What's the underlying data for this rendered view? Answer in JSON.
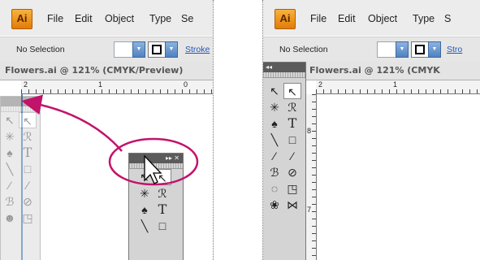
{
  "left_panel": {
    "app_logo": "Ai",
    "menus": [
      "File",
      "Edit",
      "Object",
      "Type",
      "Se"
    ],
    "control_bar": {
      "selection_label": "No Selection",
      "stroke_label": "Stroke"
    },
    "doc_tab": {
      "title": "Flowers.ai @ 121% (CMYK/Preview)"
    },
    "ruler": {
      "nums": [
        "2",
        "1",
        "0"
      ]
    },
    "floating_toolbox": {
      "tools": [
        "↖",
        "↖",
        "✳",
        "ℛ",
        "♠",
        "T",
        "╲",
        "□"
      ],
      "header_icons": "▸▸ ✕"
    },
    "ghost_toolbox": {
      "tools": [
        "↖",
        "↖",
        "✳",
        "ℛ",
        "♠",
        "T",
        "╲",
        "□",
        "⁄",
        "⁄",
        "ℬ",
        "⊘",
        "☻",
        "◳"
      ]
    }
  },
  "right_panel": {
    "app_logo": "Ai",
    "menus": [
      "File",
      "Edit",
      "Object",
      "Type",
      "S"
    ],
    "control_bar": {
      "selection_label": "No Selection",
      "stroke_label": "Stro"
    },
    "doc_tab": {
      "title": "Flowers.ai @ 121% (CMYK"
    },
    "ruler": {
      "nums": [
        "2",
        "1"
      ]
    },
    "vruler": {
      "nums": [
        "8",
        "7"
      ]
    },
    "docked_toolbox": {
      "collapse_icon": "◂◂",
      "tools": [
        "↖",
        "↖",
        "✳",
        "ℛ",
        "♠",
        "T",
        "╲",
        "□",
        "⁄",
        "⁄",
        "ℬ",
        "⊘",
        "◌",
        "◳",
        "❀",
        "⋈"
      ]
    }
  },
  "colors": {
    "arrow": "#c2136b",
    "highlight_ring": "#c2136b",
    "accent": "#4f82c1"
  }
}
